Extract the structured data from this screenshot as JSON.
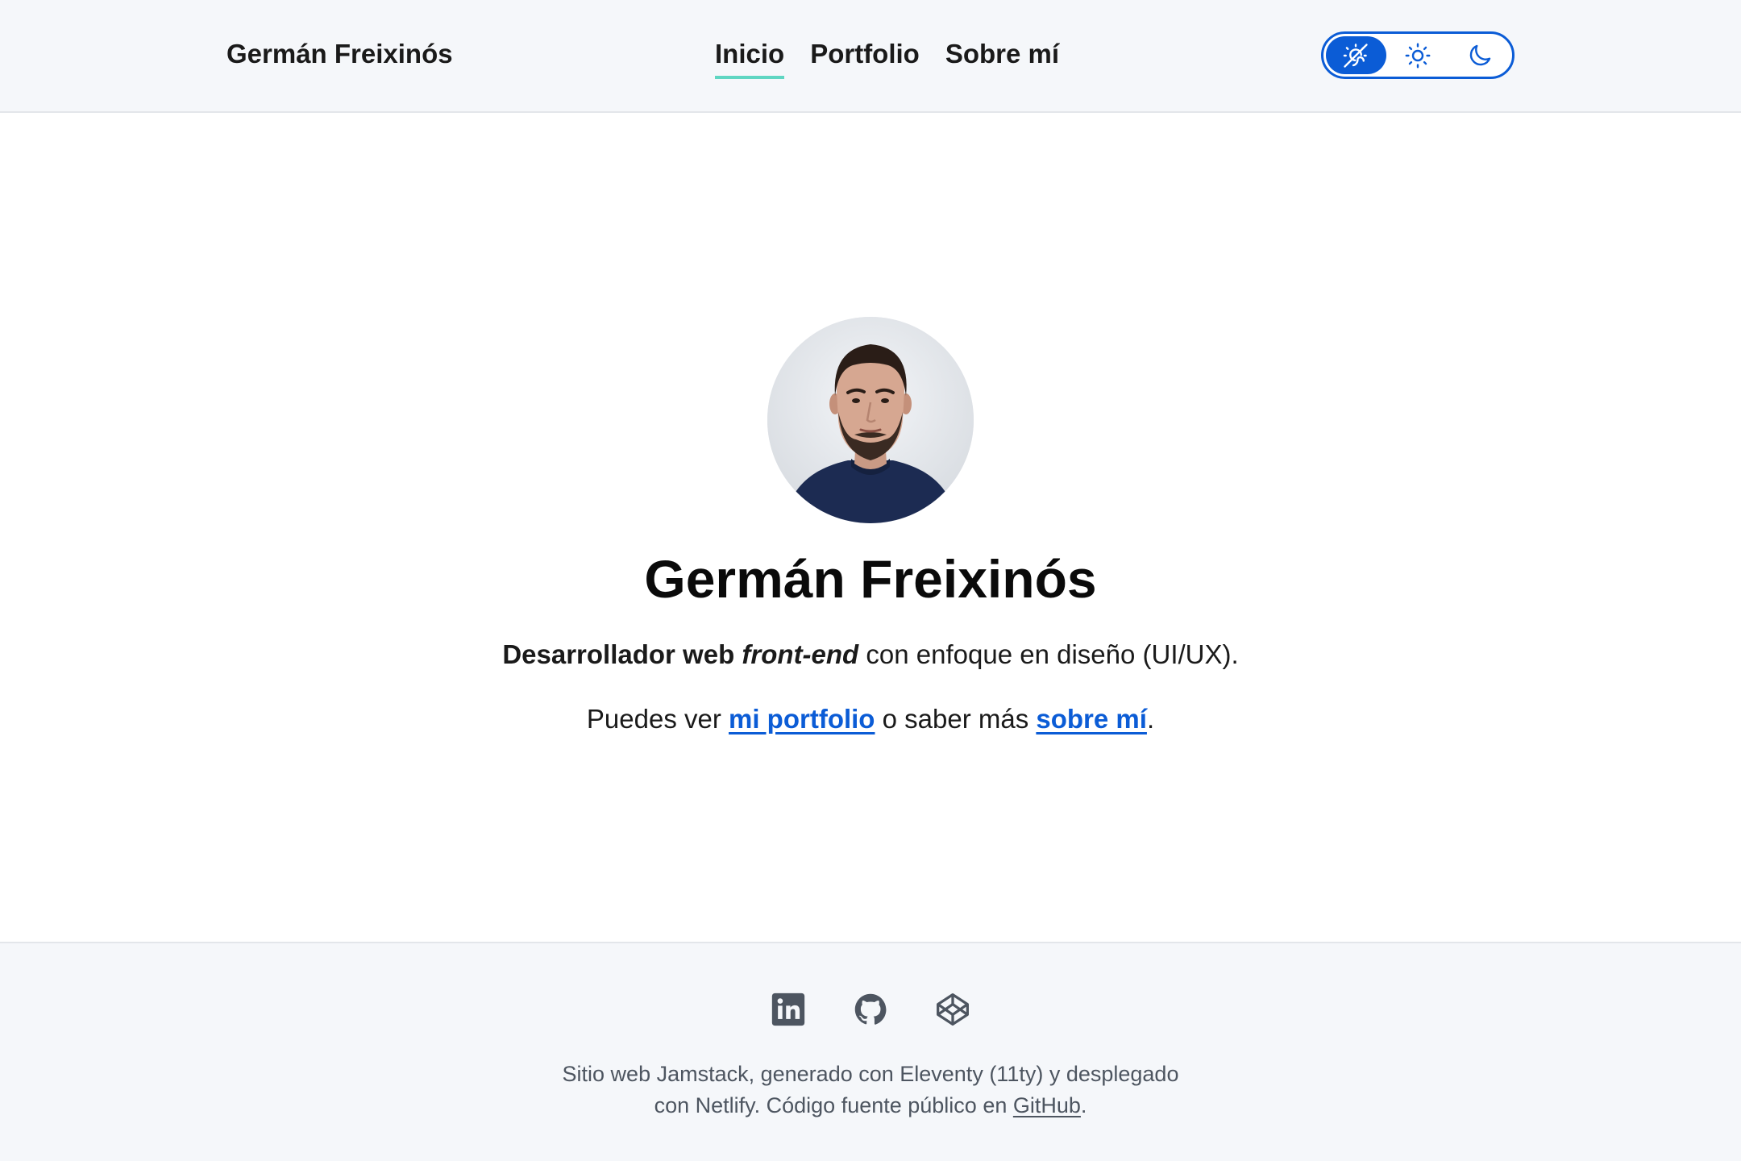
{
  "header": {
    "site_title": "Germán Freixinós",
    "nav": [
      {
        "label": "Inicio",
        "active": true
      },
      {
        "label": "Portfolio",
        "active": false
      },
      {
        "label": "Sobre mí",
        "active": false
      }
    ],
    "theme_switch": {
      "options": [
        {
          "icon": "auto-theme-icon",
          "selected": true
        },
        {
          "icon": "sun-icon",
          "selected": false
        },
        {
          "icon": "moon-icon",
          "selected": false
        }
      ]
    }
  },
  "hero": {
    "name": "Germán Freixinós",
    "tagline_bold": "Desarrollador web ",
    "tagline_italic": "front-end",
    "tagline_rest": " con enfoque en diseño (UI/UX).",
    "links_prefix": "Puedes ver ",
    "portfolio_link": "mi portfolio",
    "links_middle": " o saber más ",
    "about_link": "sobre mí",
    "links_suffix": "."
  },
  "footer": {
    "social": [
      "linkedin-icon",
      "github-icon",
      "codepen-icon"
    ],
    "line1": "Sitio web Jamstack, generado con Eleventy (11ty) y desplegado",
    "line2_prefix": "con Netlify. Código fuente público en ",
    "github_link": "GitHub",
    "line2_suffix": "."
  },
  "colors": {
    "accent": "#0b5cd6",
    "active_underline": "#5fd6c2",
    "header_bg": "#f5f7fa",
    "footer_text": "#4d5560"
  }
}
